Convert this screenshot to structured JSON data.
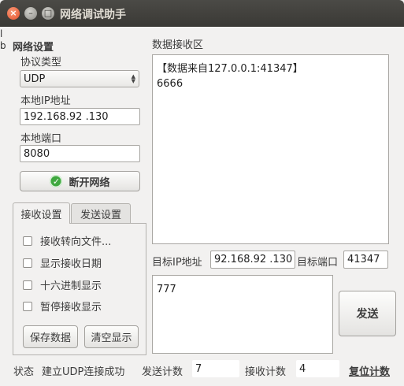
{
  "window": {
    "title": "网络调试助手"
  },
  "edge_glyphs": [
    "l",
    "b"
  ],
  "network_settings": {
    "heading": "网络设置",
    "protocol_label": "协议类型",
    "protocol_value": "UDP",
    "local_ip_label": "本地IP地址",
    "local_ip_value": "192.168.92 .130",
    "local_port_label": "本地端口",
    "local_port_value": "8080",
    "disconnect_button": "断开网络"
  },
  "tabs": {
    "receive": "接收设置",
    "send": "发送设置"
  },
  "receive_options": [
    {
      "label": "接收转向文件..."
    },
    {
      "label": "显示接收日期"
    },
    {
      "label": "十六进制显示"
    },
    {
      "label": "暂停接收显示"
    }
  ],
  "receive_buttons": {
    "save": "保存数据",
    "clear": "清空显示"
  },
  "receive_area": {
    "heading": "数据接收区",
    "line1": "【数据来自127.0.0.1:41347】",
    "line2": "6666"
  },
  "target": {
    "ip_label": "目标IP地址",
    "ip_value": "92.168.92 .130",
    "port_label": "目标端口",
    "port_value": "41347"
  },
  "send_area": {
    "text": "777",
    "send_button": "发送"
  },
  "status_bar": {
    "status_label": "状态",
    "status_text": "建立UDP连接成功",
    "sent_label": "发送计数",
    "sent_value": "7",
    "recv_label": "接收计数",
    "recv_value": "4",
    "reset_label": "复位计数"
  }
}
